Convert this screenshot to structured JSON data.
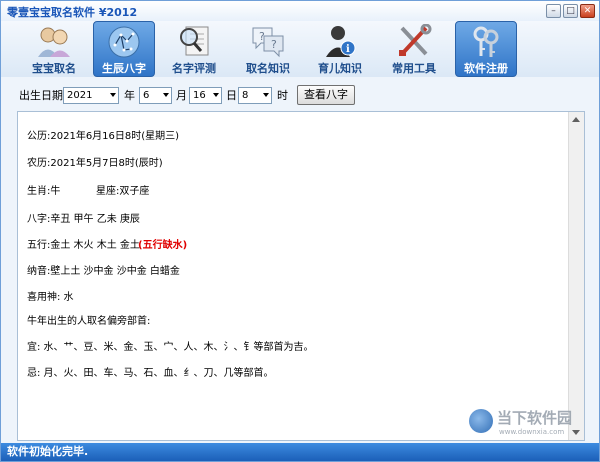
{
  "window": {
    "title": "零壹宝宝取名软件 ¥2012",
    "min_icon": "minimize-icon",
    "max_icon": "maximize-icon",
    "close_icon": "close-icon"
  },
  "toolbar": {
    "items": [
      {
        "label": "宝宝取名",
        "icon": "babies-icon",
        "active": false
      },
      {
        "label": "生辰八字",
        "icon": "constellation-icon",
        "active": true
      },
      {
        "label": "名字评测",
        "icon": "magnifier-icon",
        "active": false
      },
      {
        "label": "取名知识",
        "icon": "question-bubbles-icon",
        "active": false
      },
      {
        "label": "育儿知识",
        "icon": "user-info-icon",
        "active": false
      },
      {
        "label": "常用工具",
        "icon": "tools-icon",
        "active": false
      },
      {
        "label": "软件注册",
        "icon": "keys-icon",
        "active": false
      }
    ]
  },
  "datebar": {
    "label": "出生日期:",
    "year": "2021",
    "year_unit": "年",
    "month": "6",
    "month_unit": "月",
    "day": "16",
    "day_unit": "日",
    "hour": "8",
    "hour_unit": "时",
    "button": "查看八字"
  },
  "result": {
    "solar": "公历:2021年6月16日8时(星期三)",
    "lunar": "农历:2021年5月7日8时(辰时)",
    "zodiac": "生肖:牛",
    "constellation": "星座:双子座",
    "bazi": "八字:辛丑  甲午  乙未  庚辰",
    "wuxing": "五行:金土  木火  木土  金土",
    "wuxing_warn": "(五行缺水)",
    "nayin": "纳音:壁上土  沙中金  沙中金  白蜡金",
    "xiyong": "喜用神: 水",
    "radical_title": "牛年出生的人取名偏旁部首:",
    "good": "宜: 水、艹、豆、米、金、玉、宀、人、木、氵、钅等部首为吉。",
    "bad": "忌: 月、火、田、车、马、石、血、纟、刀、几等部首。"
  },
  "status": "软件初始化完毕.",
  "watermark": {
    "text": "当下软件园",
    "sub": "www.downxia.com"
  },
  "colors": {
    "accent": "#2f74c7",
    "title": "#1a56b8",
    "warn": "#e00000",
    "status_bg": "#1b5fb8"
  }
}
